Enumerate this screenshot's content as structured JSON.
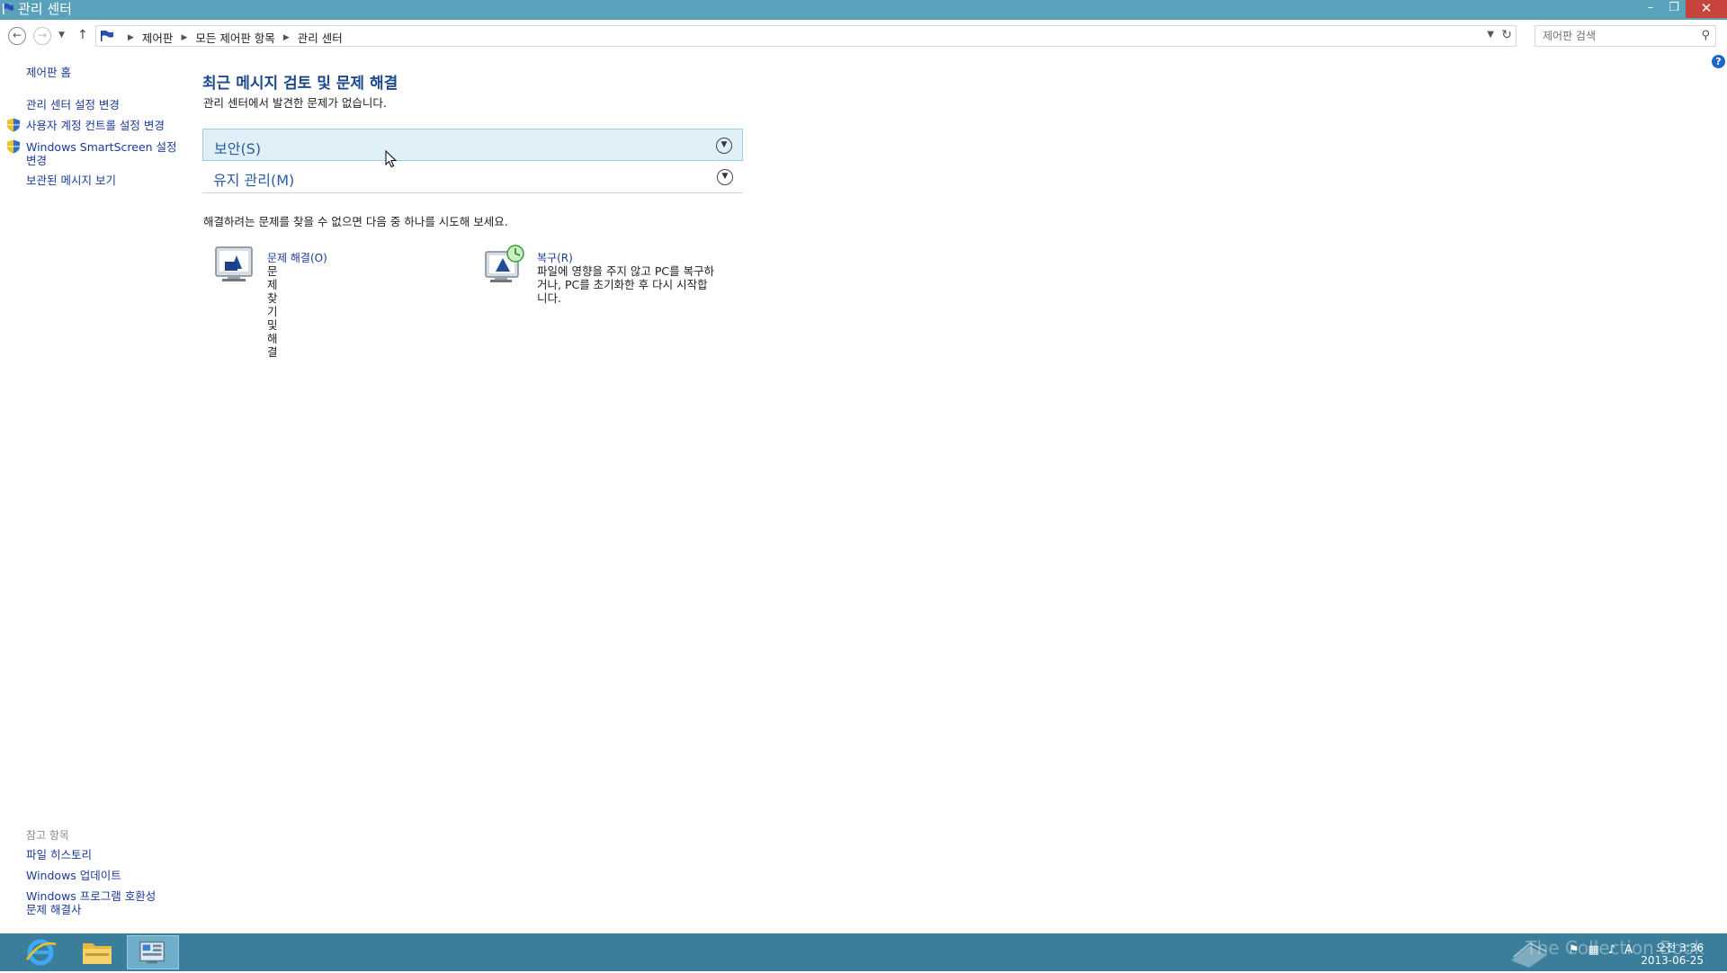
{
  "window": {
    "title": "관리 센터",
    "minimize_glyph": "–",
    "restore_glyph": "❐",
    "close_glyph": "✕"
  },
  "address": {
    "breadcrumbs": [
      "제어판",
      "모든 제어판 항목",
      "관리 센터"
    ],
    "search_placeholder": "제어판 검색"
  },
  "sidebar": {
    "items": [
      {
        "label": "제어판 홈"
      },
      {
        "label": "관리 센터 설정 변경"
      },
      {
        "label": "사용자 계정 컨트롤 설정 변경",
        "icon": "uac-shield-icon"
      },
      {
        "label": "Windows SmartScreen 설정 변경",
        "icon": "uac-shield-icon"
      },
      {
        "label": "보관된 메시지 보기"
      }
    ],
    "see_also_title": "참고 항목",
    "see_also": [
      {
        "label": "파일 히스토리"
      },
      {
        "label": "Windows 업데이트"
      },
      {
        "label": "Windows 프로그램 호환성 문제 해결사"
      }
    ]
  },
  "main": {
    "title": "최근 메시지 검토 및 문제 해결",
    "subtitle": "관리 센터에서 발견한 문제가 없습니다.",
    "sections": [
      {
        "label": "보안(S)"
      },
      {
        "label": "유지 관리(M)"
      }
    ],
    "hint": "해결하려는 문제를 찾을 수 없으면 다음 중 하나를 시도해 보세요.",
    "tasks": [
      {
        "title": "문제 해결(O)",
        "description": "문제 찾기 및 해결"
      },
      {
        "title": "복구(R)",
        "description": "파일에 영향을 주지 않고 PC를 복구하거나, PC를 초기화한 후 다시 시작합니다."
      }
    ]
  },
  "taskbar": {
    "apps": [
      "internet-explorer",
      "file-explorer",
      "control-panel"
    ],
    "watermark": "The Collection Book",
    "ime_indicator": "A",
    "clock_time": "오전 3:36",
    "clock_date": "2013-06-25"
  },
  "colors": {
    "titlebar": "#5aa1bb",
    "taskbar": "#3a7e9c",
    "link": "#1a3a99",
    "heading": "#1d4a8c",
    "section_highlight": "#e0f0f8"
  }
}
